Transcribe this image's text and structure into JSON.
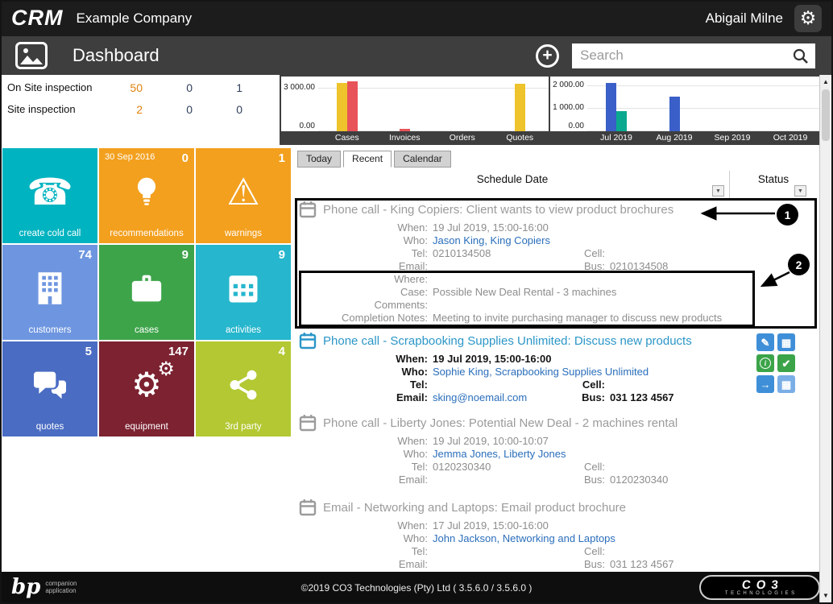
{
  "app": {
    "logo": "CRM",
    "company": "Example Company",
    "user": "Abigail Milne"
  },
  "titlebar": {
    "title": "Dashboard",
    "search_placeholder": "Search"
  },
  "stats": {
    "rows": [
      {
        "label": "On Site inspection",
        "v1": "50",
        "v2": "0",
        "v3": "1"
      },
      {
        "label": "Site inspection",
        "v1": "2",
        "v2": "0",
        "v3": "0"
      }
    ]
  },
  "chart_data": [
    {
      "type": "bar",
      "categories": [
        "Cases",
        "Invoices",
        "Orders",
        "Quotes"
      ],
      "series": [
        {
          "name": "series-yellow",
          "color": "#eec32b",
          "values": [
            3400,
            0,
            0,
            3300
          ]
        },
        {
          "name": "series-red",
          "color": "#e8535a",
          "values": [
            3500,
            160,
            0,
            0
          ]
        }
      ],
      "ymax": 3600,
      "ylim": [
        0,
        3600
      ],
      "yticks": [
        {
          "label": "3 000.00",
          "value": 3000
        },
        {
          "label": "0.00",
          "value": 0
        }
      ],
      "legend": "off",
      "grid": "on"
    },
    {
      "type": "bar",
      "categories": [
        "Jul 2019",
        "Aug 2019",
        "Sep 2019",
        "Oct 2019"
      ],
      "series": [
        {
          "name": "series-blue",
          "color": "#3a5fc8",
          "values": [
            2150,
            1550,
            0,
            0
          ]
        },
        {
          "name": "series-teal",
          "color": "#0aa98f",
          "values": [
            900,
            0,
            0,
            0
          ]
        }
      ],
      "ymax": 2300,
      "ylim": [
        0,
        2300
      ],
      "yticks": [
        {
          "label": "2 000.00",
          "value": 2000
        },
        {
          "label": "1 000.00",
          "value": 1000
        },
        {
          "label": "0.00",
          "value": 0
        }
      ],
      "legend": "off",
      "grid": "on"
    }
  ],
  "tiles": [
    {
      "label": "create cold call",
      "count": "",
      "date": "",
      "color": "#00b3c0"
    },
    {
      "label": "recommendations",
      "count": "0",
      "date": "30 Sep 2016",
      "color": "#f3a01f"
    },
    {
      "label": "warnings",
      "count": "1",
      "date": "",
      "color": "#f3a01f"
    },
    {
      "label": "customers",
      "count": "74",
      "date": "",
      "color": "#6e96e0"
    },
    {
      "label": "cases",
      "count": "9",
      "date": "",
      "color": "#3da44a"
    },
    {
      "label": "activities",
      "count": "9",
      "date": "",
      "color": "#26b6cd"
    },
    {
      "label": "quotes",
      "count": "5",
      "date": "",
      "color": "#4a6cc3"
    },
    {
      "label": "equipment",
      "count": "147",
      "date": "",
      "color": "#7c2231"
    },
    {
      "label": "3rd party",
      "count": "4",
      "date": "",
      "color": "#b3c832"
    }
  ],
  "panel": {
    "tabs": [
      {
        "label": "Today"
      },
      {
        "label": "Recent"
      },
      {
        "label": "Calendar"
      }
    ],
    "active_tab": "Recent",
    "columns": {
      "schedule": "Schedule Date",
      "status": "Status"
    },
    "labels": {
      "when": "When:",
      "who": "Who:",
      "tel": "Tel:",
      "cell": "Cell:",
      "email": "Email:",
      "bus": "Bus:",
      "where": "Where:",
      "case": "Case:",
      "comments": "Comments:",
      "completion": "Completion Notes:"
    },
    "items": [
      {
        "title": "Phone call - King Copiers: Client wants to view product brochures",
        "when": "19 Jul 2019, 15:00-16:00",
        "who": "Jason King, King Copiers",
        "tel": "0210134508",
        "cell": "",
        "email": "",
        "bus": "0210134508",
        "where": "",
        "case": "Possible New Deal Rental - 3 machines",
        "comments": "",
        "completion": "Meeting to invite purchasing manager to discuss new products"
      },
      {
        "title": "Phone call - Scrapbooking Supplies Unlimited: Discuss new products",
        "when": "19 Jul 2019, 15:00-16:00",
        "who": "Sophie King, Scrapbooking Supplies Unlimited",
        "tel": "",
        "cell": "",
        "email": "sking@noemail.com",
        "bus": "031 123 4567"
      },
      {
        "title": "Phone call - Liberty Jones: Potential New Deal - 2 machines rental",
        "when": "19 Jul 2019, 10:00-10:07",
        "who": "Jemma Jones, Liberty Jones",
        "tel": "0120230340",
        "cell": "",
        "email": "",
        "bus": "0120230340"
      },
      {
        "title": "Email - Networking and Laptops: Email product brochure",
        "when": "17 Jul 2019, 15:00-16:00",
        "who": "John Jackson, Networking and Laptops",
        "tel": "",
        "cell": "",
        "email": "",
        "bus": "031 123 4567"
      }
    ]
  },
  "annotations": {
    "n1": "1",
    "n2": "2"
  },
  "icons": {
    "gear": "⚙",
    "phone": "☎",
    "warning": "⚠",
    "plus": "+",
    "dropdown": "▼",
    "scroll_up": "▲",
    "scroll_down": "▼",
    "pencil": "✎",
    "calendar_alt": "▦",
    "info": "i",
    "check": "✔",
    "arrow_right": "→",
    "grid": "▦"
  },
  "colors": {
    "accent_orange": "#e2820d",
    "link_blue": "#2a6ebb",
    "active_title_teal": "#2b96c8",
    "action_blue": "#3f8fd8",
    "action_green": "#3ba449"
  },
  "footer": {
    "copyright": "©2019 CO3 Technologies (Pty) Ltd ( 3.5.6.0 / 3.5.6.0 )",
    "left_logo_main": "bp",
    "left_logo_sub1": "companion",
    "left_logo_sub2": "application",
    "right_logo_main": "CO3",
    "right_logo_sub": "TECHNOLOGIES"
  }
}
